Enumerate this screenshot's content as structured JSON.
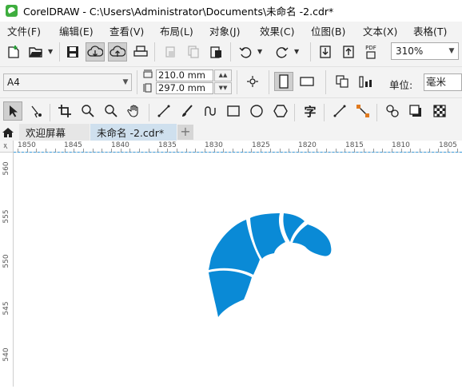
{
  "window": {
    "title": "CorelDRAW - C:\\Users\\Administrator\\Documents\\未命名 -2.cdr*"
  },
  "menu": [
    {
      "label": "文件(F)"
    },
    {
      "label": "编辑(E)"
    },
    {
      "label": "查看(V)"
    },
    {
      "label": "布局(L)"
    },
    {
      "label": "对象(J)"
    },
    {
      "label": "效果(C)"
    },
    {
      "label": "位图(B)"
    },
    {
      "label": "文本(X)"
    },
    {
      "label": "表格(T)"
    }
  ],
  "toolbar": {
    "zoom_value": "310%",
    "pdf_label": "PDF"
  },
  "property_bar": {
    "page_size": "A4",
    "width": "210.0 mm",
    "height": "297.0 mm",
    "units_label": "单位:",
    "units_value": "毫米"
  },
  "toolbox": {
    "text_tool_glyph": "字"
  },
  "tabs": {
    "welcome": "欢迎屏幕",
    "document": "未命名 -2.cdr*",
    "add": "+"
  },
  "rulers": {
    "horizontal_ticks": [
      "1850",
      "1845",
      "1840",
      "1835",
      "1830",
      "1825",
      "1820",
      "1815",
      "1810",
      "1805"
    ],
    "vertical_ticks": [
      "560",
      "555",
      "550",
      "545",
      "540"
    ]
  },
  "canvas": {
    "shape_color": "#0a8ad6"
  }
}
